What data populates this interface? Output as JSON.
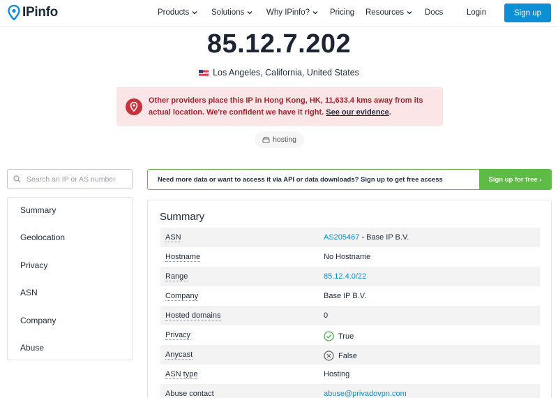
{
  "brand": {
    "logo_text": "IPinfo",
    "accent": "#0d8fd6",
    "success": "#5dbb46",
    "danger": "#a3242b"
  },
  "nav": {
    "items": [
      {
        "label": "Products",
        "dropdown": true
      },
      {
        "label": "Solutions",
        "dropdown": true
      },
      {
        "label": "Why IPinfo?",
        "dropdown": true
      },
      {
        "label": "Pricing",
        "dropdown": false
      },
      {
        "label": "Resources",
        "dropdown": true
      },
      {
        "label": "Docs",
        "dropdown": false
      }
    ],
    "login_label": "Login",
    "signup_label": "Sign up"
  },
  "hero": {
    "ip": "85.12.7.202",
    "location": "Los Angeles, California, United States",
    "flag_icon": "us-flag-icon",
    "alert": {
      "text": "Other providers place this IP in Hong Kong, HK, 11,633.4 kms away from its actual location. We're confident we have it right.",
      "link_text": "See our evidence",
      "suffix": "."
    },
    "tag": "hosting"
  },
  "search": {
    "placeholder": "Search an IP or AS number"
  },
  "sidebar": {
    "items": [
      "Summary",
      "Geolocation",
      "Privacy",
      "ASN",
      "Company",
      "Abuse"
    ]
  },
  "banner": {
    "text": "Need more data or want to access it via API or data downloads? Sign up to get free access",
    "button": "Sign up for free ›"
  },
  "summary": {
    "title": "Summary",
    "rows": [
      {
        "label": "ASN",
        "value_link": "AS205467",
        "value": " - Base IP B.V."
      },
      {
        "label": "Hostname",
        "value": "No Hostname"
      },
      {
        "label": "Range",
        "value_link": "85.12.4.0/22"
      },
      {
        "label": "Company",
        "value": "Base IP B.V."
      },
      {
        "label": "Hosted domains",
        "value": "0"
      },
      {
        "label": "Privacy",
        "value": "True",
        "icon": "check-circle-icon"
      },
      {
        "label": "Anycast",
        "value": "False",
        "icon": "x-circle-icon"
      },
      {
        "label": "ASN type",
        "value": "Hosting"
      },
      {
        "label": "Abuse contact",
        "value_link": "abuse@privadovpn.com"
      }
    ]
  }
}
